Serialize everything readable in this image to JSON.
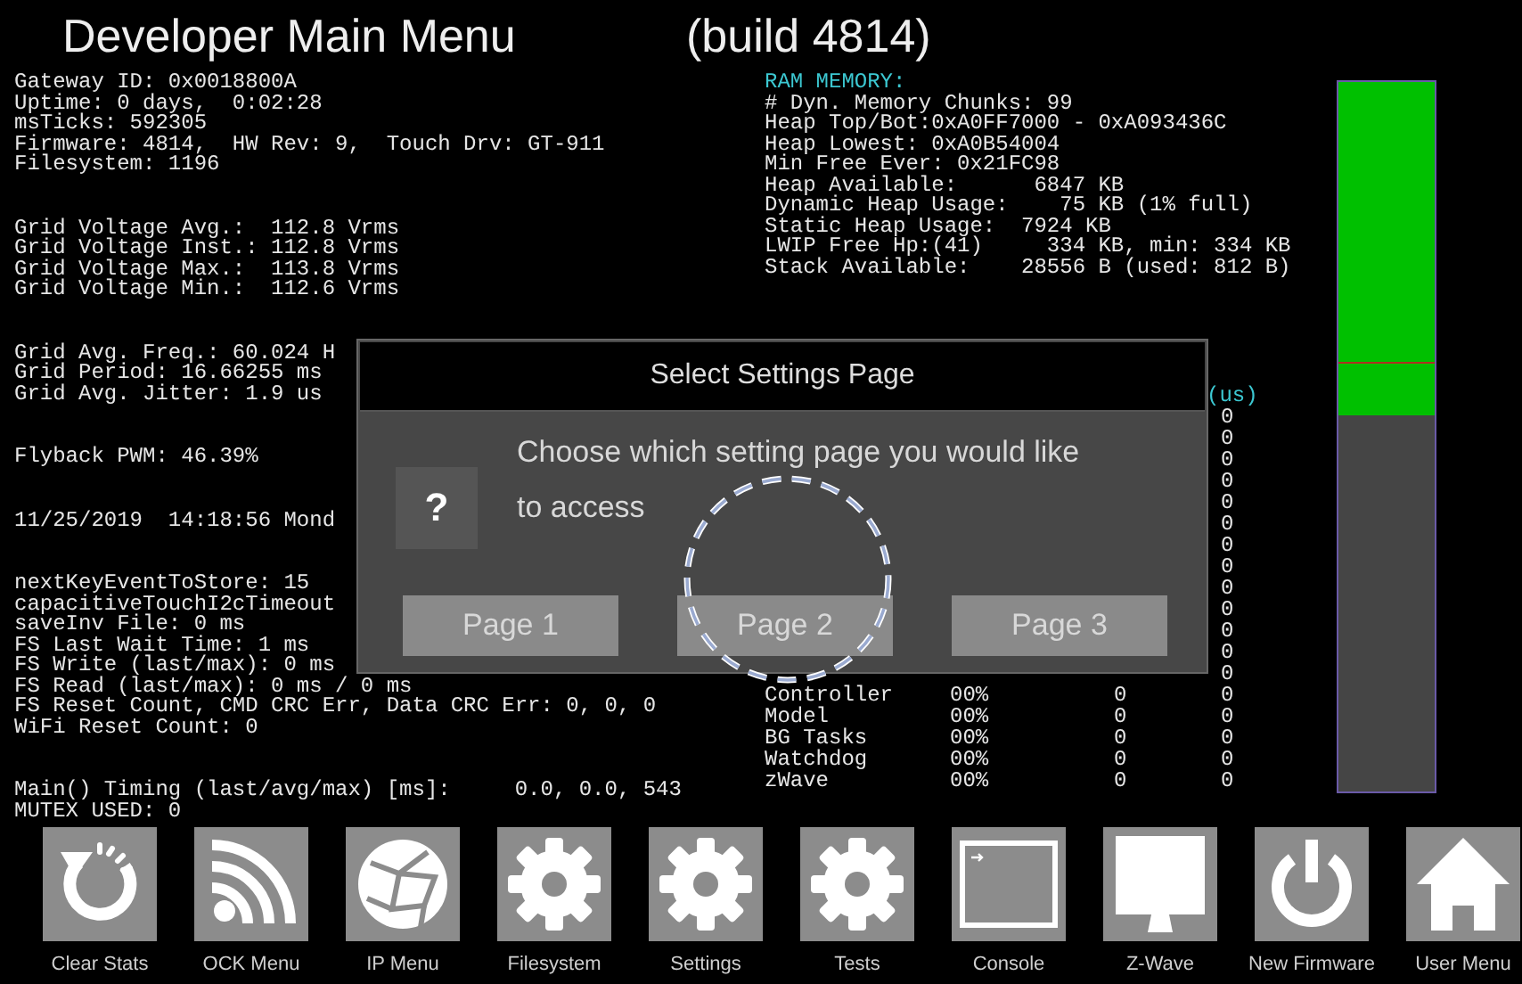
{
  "title": "Developer Main Menu",
  "build": "(build 4814)",
  "status_groups": [
    [
      "Gateway ID: 0x0018800A",
      "Uptime: 0 days,  0:02:28",
      "msTicks: 592305",
      "Firmware: 4814,  HW Rev: 9,  Touch Drv: GT-911",
      "Filesystem: 1196"
    ],
    [
      "Grid Voltage Avg.:  112.8 Vrms",
      "Grid Voltage Inst.: 112.8 Vrms",
      "Grid Voltage Max.:  113.8 Vrms",
      "Grid Voltage Min.:  112.6 Vrms"
    ],
    [
      "Grid Avg. Freq.: 60.024 H",
      "Grid Period: 16.66255 ms",
      "Grid Avg. Jitter: 1.9 us"
    ],
    [
      "Flyback PWM: 46.39%"
    ],
    [
      "11/25/2019  14:18:56 Mond"
    ],
    [
      "nextKeyEventToStore: 15",
      "capacitiveTouchI2cTimeout",
      "saveInv File: 0 ms",
      "FS Last Wait Time: 1 ms",
      "FS Write (last/max): 0 ms",
      "FS Read (last/max): 0 ms / 0 ms",
      "FS Reset Count, CMD CRC Err, Data CRC Err: 0, 0, 0",
      "WiFi Reset Count: 0"
    ],
    [
      "Main() Timing (last/avg/max) [ms]:     0.0, 0.0, 543",
      "MUTEX USED: 0"
    ]
  ],
  "ram_memory": {
    "heading": "RAM MEMORY:",
    "lines": [
      "# Dyn. Memory Chunks: 99",
      "Heap Top/Bot:0xA0FF7000 - 0xA093436C",
      "Heap Lowest: 0xA0B54004",
      "Min Free Ever: 0x21FC98",
      "Heap Available:      6847 KB",
      "Dynamic Heap Usage:    75 KB (1% full)",
      "Static Heap Usage:  7924 KB",
      "LWIP Free Hp:(41)     334 KB, min: 334 KB",
      "Stack Available:    28556 B (used: 812 B)"
    ]
  },
  "task_table": {
    "column_4_heading": "(us)",
    "rows": [
      {
        "column_4": "0"
      },
      {
        "column_4": "0"
      },
      {
        "column_4": "0"
      },
      {
        "column_4": "0"
      },
      {
        "column_4": "0"
      },
      {
        "column_4": "0"
      },
      {
        "column_4": "0"
      },
      {
        "column_4": "0"
      },
      {
        "column_4": "0"
      },
      {
        "column_4": "0"
      },
      {
        "column_4": "0"
      },
      {
        "column_4": "0"
      },
      {
        "column_4": "0"
      },
      {
        "column_1": "Controller",
        "column_2": "00%",
        "column_3": "0",
        "column_4": "0"
      },
      {
        "column_1": "Model",
        "column_2": "00%",
        "column_3": "0",
        "column_4": "0"
      },
      {
        "column_1": "BG Tasks",
        "column_2": "00%",
        "column_3": "0",
        "column_4": "0"
      },
      {
        "column_1": "Watchdog",
        "column_2": "00%",
        "column_3": "0",
        "column_4": "0"
      },
      {
        "column_1": "zWave",
        "column_2": "00%",
        "column_3": "0",
        "column_4": "0"
      }
    ]
  },
  "memory_bar": {
    "level": 0.47
  },
  "dialog": {
    "title": "Select Settings Page",
    "icon": "?",
    "message": "Choose which setting page you would like to access",
    "buttons": [
      "Page 1",
      "Page 2",
      "Page 3"
    ]
  },
  "toolbar": [
    {
      "kind": "refresh",
      "label": "Clear Stats"
    },
    {
      "kind": "signal",
      "label": "OCK Menu"
    },
    {
      "kind": "globe",
      "label": "IP Menu"
    },
    {
      "kind": "gear",
      "label": "Filesystem"
    },
    {
      "kind": "gear",
      "label": "Settings"
    },
    {
      "kind": "gear",
      "label": "Tests"
    },
    {
      "kind": "terminal",
      "label": "Console"
    },
    {
      "kind": "monitor",
      "label": "Z-Wave"
    },
    {
      "kind": "power",
      "label": "New Firmware"
    },
    {
      "kind": "home",
      "label": "User Menu"
    }
  ]
}
